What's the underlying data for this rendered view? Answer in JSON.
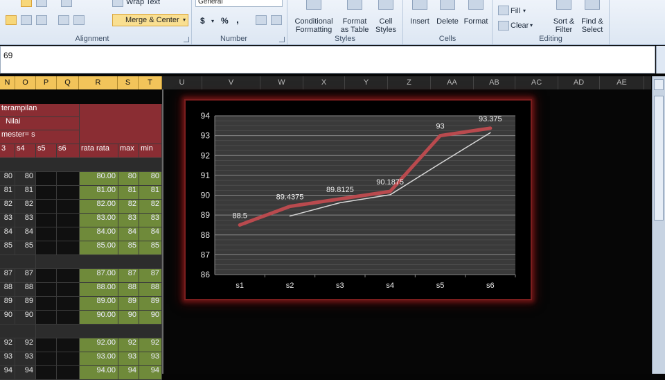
{
  "ribbon": {
    "wrap_text": "Wrap Text",
    "merge_center": "Merge & Center",
    "number_format": "General",
    "currency": "$",
    "percent": "%",
    "comma": ",",
    "inc_dec": "+.0\n.00",
    "groups": {
      "alignment": "Alignment",
      "number": "Number",
      "styles": "Styles",
      "cells": "Cells",
      "editing": "Editing"
    },
    "buttons": {
      "conditional_formatting": [
        "Conditional",
        "Formatting"
      ],
      "format_as_table": [
        "Format",
        "as Table"
      ],
      "cell_styles": [
        "Cell",
        "Styles"
      ],
      "insert": "Insert",
      "delete": "Delete",
      "format": "Format",
      "fill": "Fill",
      "clear": "Clear",
      "sort_filter": [
        "Sort &",
        "Filter"
      ],
      "find_select": [
        "Find &",
        "Select"
      ]
    }
  },
  "formula_bar": {
    "value": "69"
  },
  "columns": [
    "N",
    "O",
    "P",
    "Q",
    "R",
    "S",
    "T",
    "U",
    "V",
    "W",
    "X",
    "Y",
    "Z",
    "AA",
    "AB",
    "AC",
    "AD",
    "AE"
  ],
  "sheet": {
    "header_keterampilan": "terampilan",
    "header_nilai": "Nilai",
    "header_semester": "mester= s",
    "subheaders": [
      "3",
      "s4",
      "s5",
      "s6",
      "rata rata",
      "max",
      "min"
    ],
    "rows": [
      [
        "80",
        "80",
        "",
        "",
        "80.00",
        "80",
        "80"
      ],
      [
        "81",
        "81",
        "",
        "",
        "81.00",
        "81",
        "81"
      ],
      [
        "82",
        "82",
        "",
        "",
        "82.00",
        "82",
        "82"
      ],
      [
        "83",
        "83",
        "",
        "",
        "83.00",
        "83",
        "83"
      ],
      [
        "84",
        "84",
        "",
        "",
        "84.00",
        "84",
        "84"
      ],
      [
        "85",
        "85",
        "",
        "",
        "85.00",
        "85",
        "85"
      ],
      null,
      [
        "87",
        "87",
        "",
        "",
        "87.00",
        "87",
        "87"
      ],
      [
        "88",
        "88",
        "",
        "",
        "88.00",
        "88",
        "88"
      ],
      [
        "89",
        "89",
        "",
        "",
        "89.00",
        "89",
        "89"
      ],
      [
        "90",
        "90",
        "",
        "",
        "90.00",
        "90",
        "90"
      ],
      null,
      [
        "92",
        "92",
        "",
        "",
        "92.00",
        "92",
        "92"
      ],
      [
        "93",
        "93",
        "",
        "",
        "93.00",
        "93",
        "93"
      ],
      [
        "94",
        "94",
        "",
        "",
        "94.00",
        "94",
        "94"
      ]
    ]
  },
  "chart_data": {
    "type": "line",
    "categories": [
      "s1",
      "s2",
      "s3",
      "s4",
      "s5",
      "s6"
    ],
    "series": [
      {
        "values": [
          88.5,
          89.4375,
          89.8125,
          90.1875,
          93,
          93.375
        ],
        "color": "#b94a4e"
      },
      {
        "values": [
          null,
          88.95,
          89.62,
          90.02,
          91.6,
          93.15
        ],
        "color": "#d8d8d8"
      }
    ],
    "data_labels": [
      "88.5",
      "89.4375",
      "89.8125",
      "90.1875",
      "93",
      "93.375"
    ],
    "yticks": [
      "86",
      "87",
      "88",
      "89",
      "90",
      "91",
      "92",
      "93",
      "94"
    ],
    "ylim": [
      86,
      94
    ],
    "grid": true,
    "plot_bg": "#3a3a3a",
    "chart_bg": "#000000",
    "border_color": "#7a1d1d"
  }
}
